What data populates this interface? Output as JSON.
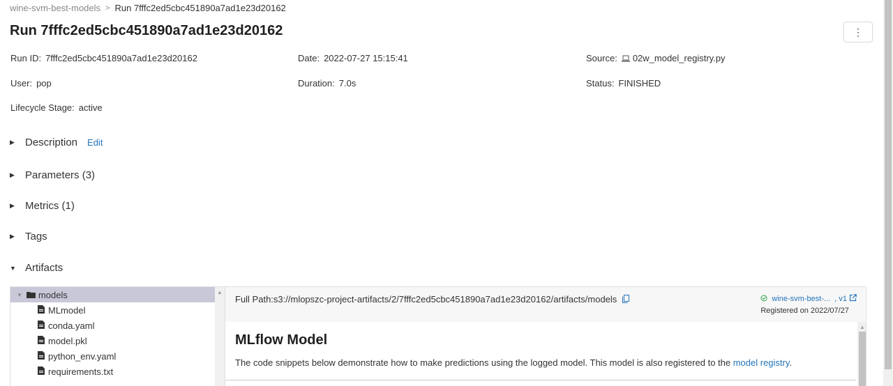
{
  "breadcrumb": {
    "experiment": "wine-svm-best-models",
    "current": "Run 7fffc2ed5cbc451890a7ad1e23d20162"
  },
  "title": "Run 7fffc2ed5cbc451890a7ad1e23d20162",
  "menu_icon": "⋮",
  "meta": {
    "run_id": {
      "label": "Run ID:",
      "value": "7fffc2ed5cbc451890a7ad1e23d20162"
    },
    "date": {
      "label": "Date:",
      "value": "2022-07-27 15:15:41"
    },
    "source": {
      "label": "Source:",
      "value": "02w_model_registry.py"
    },
    "user": {
      "label": "User:",
      "value": "pop"
    },
    "duration": {
      "label": "Duration:",
      "value": "7.0s"
    },
    "status": {
      "label": "Status:",
      "value": "FINISHED"
    },
    "lifecycle": {
      "label": "Lifecycle Stage:",
      "value": "active"
    }
  },
  "sections": {
    "description": "Description",
    "edit": "Edit",
    "parameters": "Parameters (3)",
    "metrics": "Metrics (1)",
    "tags": "Tags",
    "artifacts": "Artifacts"
  },
  "tree": {
    "folder": "models",
    "files": [
      "MLmodel",
      "conda.yaml",
      "model.pkl",
      "python_env.yaml",
      "requirements.txt"
    ]
  },
  "artifact_panel": {
    "full_path_label": "Full Path:",
    "full_path": "s3://mlopszc-project-artifacts/2/7fffc2ed5cbc451890a7ad1e23d20162/artifacts/models",
    "registered_model": "wine-svm-best-...",
    "version": ", v1",
    "registered_on": "Registered on 2022/07/27",
    "heading": "MLflow Model",
    "desc_text": "The code snippets below demonstrate how to make predictions using the logged model. This model is also registered to the ",
    "desc_link": "model registry",
    "desc_end": "."
  },
  "colors": {
    "link": "#2374bb",
    "selected_row": "#c9c8d9",
    "success": "#2ea44f"
  }
}
